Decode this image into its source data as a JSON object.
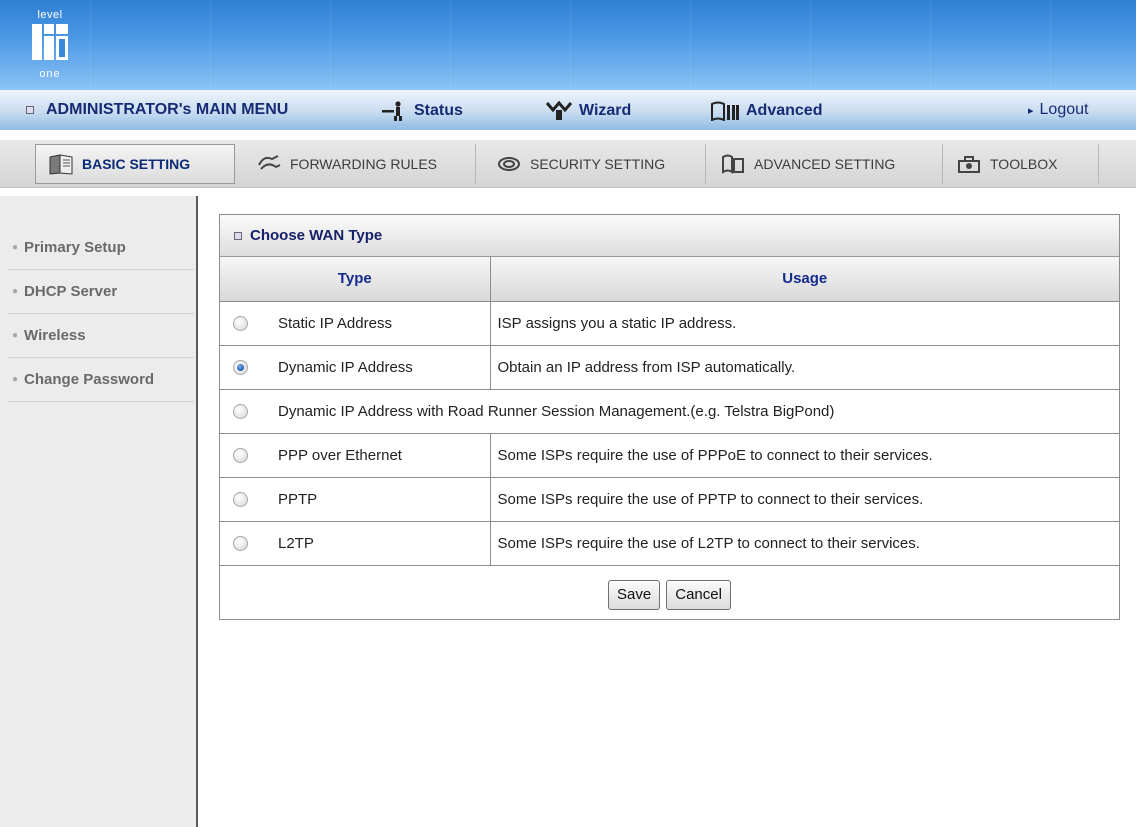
{
  "branding": {
    "logo_top": "level",
    "logo_bottom": "one"
  },
  "menubar": {
    "title": "ADMINISTRATOR's MAIN MENU",
    "status": "Status",
    "wizard": "Wizard",
    "advanced": "Advanced",
    "logout": "Logout"
  },
  "tabs": [
    {
      "label": "BASIC SETTING",
      "active": true
    },
    {
      "label": "FORWARDING RULES",
      "active": false
    },
    {
      "label": "SECURITY SETTING",
      "active": false
    },
    {
      "label": "ADVANCED SETTING",
      "active": false
    },
    {
      "label": "TOOLBOX",
      "active": false
    }
  ],
  "sidebar": {
    "items": [
      {
        "label": "Primary Setup"
      },
      {
        "label": "DHCP Server"
      },
      {
        "label": "Wireless"
      },
      {
        "label": "Change Password"
      }
    ]
  },
  "panel": {
    "title": "Choose WAN Type",
    "col_type": "Type",
    "col_usage": "Usage",
    "rows": [
      {
        "type": "Static IP Address",
        "usage": "ISP assigns you a static IP address.",
        "selected": false
      },
      {
        "type": "Dynamic IP Address",
        "usage": "Obtain an IP address from ISP automatically.",
        "selected": true
      },
      {
        "type": "Dynamic IP Address with Road Runner Session Management.(e.g. Telstra BigPond)",
        "usage": "",
        "selected": false
      },
      {
        "type": "PPP over Ethernet",
        "usage": "Some ISPs require the use of PPPoE to connect to their services.",
        "selected": false
      },
      {
        "type": "PPTP",
        "usage": "Some ISPs require the use of PPTP to connect to their services.",
        "selected": false
      },
      {
        "type": "L2TP",
        "usage": "Some ISPs require the use of L2TP to connect to their services.",
        "selected": false
      }
    ],
    "save_label": "Save",
    "cancel_label": "Cancel"
  },
  "colors": {
    "banner": "#4a97e4",
    "menu_text": "#162b73",
    "header_text": "#152b8e",
    "radio_selected": "#1f58b0"
  }
}
